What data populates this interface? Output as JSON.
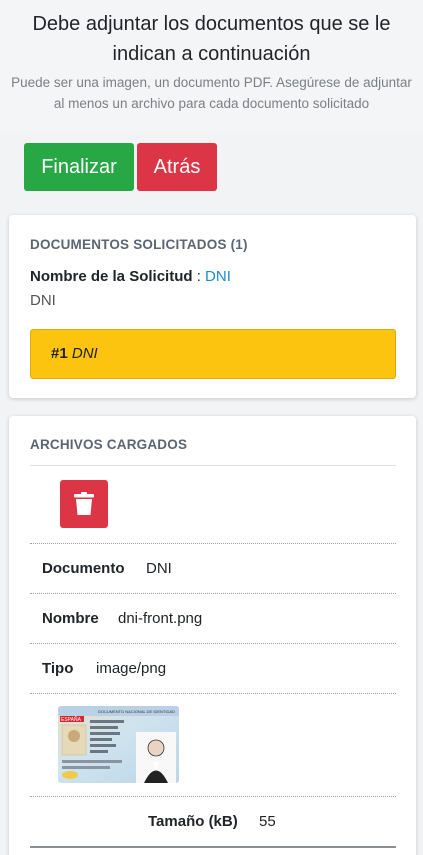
{
  "header": {
    "title": "Debe adjuntar los documentos que se le indican a continuación",
    "subtitle": "Puede ser una imagen, un documento PDF. Asegúrese de adjuntar al menos un archivo para cada documento solicitado"
  },
  "actions": {
    "finish_label": "Finalizar",
    "back_label": "Atrás"
  },
  "requested": {
    "heading": "DOCUMENTOS SOLICITADOS (1)",
    "request_name_label": "Nombre de la Solicitud",
    "separator": " : ",
    "request_name_value": "DNI",
    "description": "DNI",
    "documents": [
      {
        "number": "#1",
        "name": "DNI"
      }
    ]
  },
  "uploaded": {
    "heading": "ARCHIVOS CARGADOS",
    "delete_icon": "trash-icon",
    "fields": {
      "documento_label": "Documento",
      "documento_value": "DNI",
      "nombre_label": "Nombre",
      "nombre_value": "dni-front.png",
      "tipo_label": "Tipo",
      "tipo_value": "image/png",
      "size_label": "Tamaño (kB)",
      "size_value": "55"
    },
    "thumbnail": {
      "country_text": "ESPAÑA",
      "header_text": "DOCUMENTO NACIONAL DE IDENTIDAD"
    }
  },
  "colors": {
    "success": "#28a745",
    "danger": "#dc3545",
    "warning": "#fcc30f",
    "link": "#1a8ccf"
  }
}
